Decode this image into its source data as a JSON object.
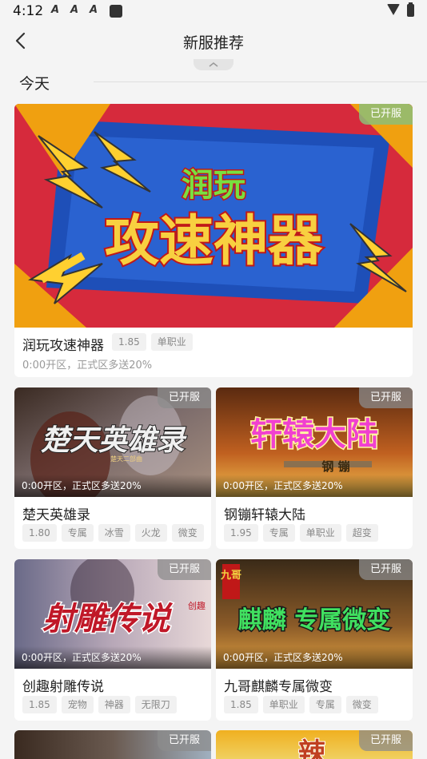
{
  "status": {
    "time": "4:12",
    "a1": "A",
    "a2": "A",
    "a3": "A"
  },
  "header": {
    "title": "新服推荐"
  },
  "section": {
    "title": "今天"
  },
  "featured": {
    "name": "润玩攻速神器",
    "badge": "已开服",
    "art_line1": "润玩",
    "art_line2": "攻速神器",
    "tags": [
      "1.85",
      "单职业"
    ],
    "note": "0:00开区，正式区多送20%"
  },
  "cards": [
    {
      "name": "楚天英雄录",
      "badge": "已开服",
      "art": "楚天英雄录",
      "art_sub": "楚天二部曲",
      "note": "0:00开区，正式区多送20%",
      "tags": [
        "1.80",
        "专属",
        "冰雪",
        "火龙",
        "微变"
      ],
      "colors": [
        "#3a2a22",
        "#7a6a6a",
        "#a89080"
      ]
    },
    {
      "name": "钢镚轩辕大陆",
      "badge": "已开服",
      "art": "轩辕大陆",
      "art_sub": "钢 镚",
      "note": "0:00开区，正式区多送20%",
      "tags": [
        "1.95",
        "专属",
        "单职业",
        "超变"
      ],
      "colors": [
        "#5a2a10",
        "#c06020",
        "#f0c050"
      ]
    },
    {
      "name": "创趣射雕传说",
      "badge": "已开服",
      "art": "射雕传说",
      "art_sub": "创趣",
      "note": "0:00开区，正式区多送20%",
      "tags": [
        "1.85",
        "宠物",
        "神器",
        "无限刀"
      ],
      "colors": [
        "#6a6a88",
        "#b8a8b8",
        "#e8d8d8"
      ]
    },
    {
      "name": "九哥麒麟专属微变",
      "badge": "已开服",
      "art": "麒麟 专属微变",
      "art_sub": "九哥",
      "note": "0:00开区，正式区多送20%",
      "tags": [
        "1.85",
        "单职业",
        "专属",
        "微变"
      ],
      "colors": [
        "#3a2a18",
        "#8a5a28",
        "#e0a040"
      ]
    },
    {
      "badge": "已开服",
      "colors": [
        "#3a2a20",
        "#6a5a50",
        "#a0b0c0"
      ]
    },
    {
      "badge": "已开服",
      "art": "辣",
      "colors": [
        "#f0b020",
        "#f0d060",
        "#c04020"
      ]
    }
  ]
}
